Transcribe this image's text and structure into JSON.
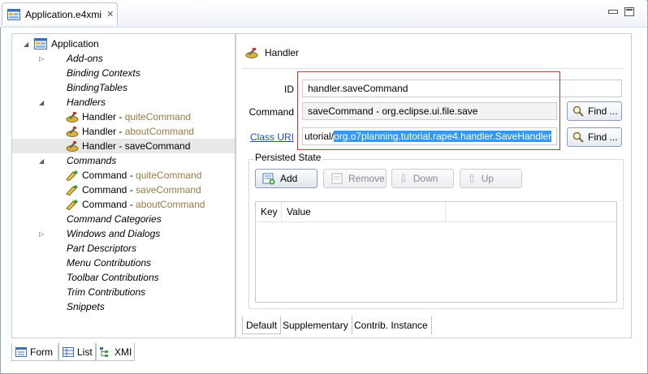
{
  "editor": {
    "tab_title": "Application.e4xmi",
    "close_icon": "close-icon",
    "colors": {
      "frame": "#8ea4c1",
      "muted_text": "#9a7b45",
      "link": "#1d4cc9",
      "selection": "#3399ff",
      "highlight_box": "#d93030"
    }
  },
  "tree": {
    "root": "Application",
    "addons": "Add-ons",
    "binding_contexts": "Binding Contexts",
    "binding_tables": "BindingTables",
    "handlers": "Handlers",
    "handler_items": [
      {
        "prefix": "Handler",
        "sep": " - ",
        "name": "quiteCommand"
      },
      {
        "prefix": "Handler",
        "sep": " - ",
        "name": "aboutCommand"
      },
      {
        "prefix": "Handler",
        "sep": " - ",
        "name": "saveCommand"
      }
    ],
    "commands": "Commands",
    "command_items": [
      {
        "prefix": "Command",
        "sep": " - ",
        "name": "quiteCommand"
      },
      {
        "prefix": "Command",
        "sep": " - ",
        "name": "saveCommand"
      },
      {
        "prefix": "Command",
        "sep": " - ",
        "name": "aboutCommand"
      }
    ],
    "command_categories": "Command Categories",
    "windows_dialogs": "Windows and Dialogs",
    "part_descriptors": "Part Descriptors",
    "menu_contributions": "Menu Contributions",
    "toolbar_contributions": "Toolbar Contributions",
    "trim_contributions": "Trim Contributions",
    "snippets": "Snippets"
  },
  "detail": {
    "header": "Handler",
    "id_label": "ID",
    "id_value": "handler.saveCommand",
    "command_label": "Command",
    "command_value": "saveCommand - org.eclipse.ui.file.save",
    "class_uri_label": "Class URI",
    "class_uri_prefix": "utorial/",
    "class_uri_selected": "org.o7planning.tutorial.rape4.handler.SaveHandler",
    "find_label": "Find ...",
    "persisted_state_title": "Persisted State",
    "buttons": {
      "add": "Add",
      "remove": "Remove",
      "down": "Down",
      "up": "Up"
    },
    "table_headers": [
      "Key",
      "Value"
    ],
    "tabs": [
      "Default",
      "Supplementary",
      "Contrib. Instance"
    ]
  },
  "views": {
    "tabs": [
      "Form",
      "List",
      "XMI"
    ]
  }
}
